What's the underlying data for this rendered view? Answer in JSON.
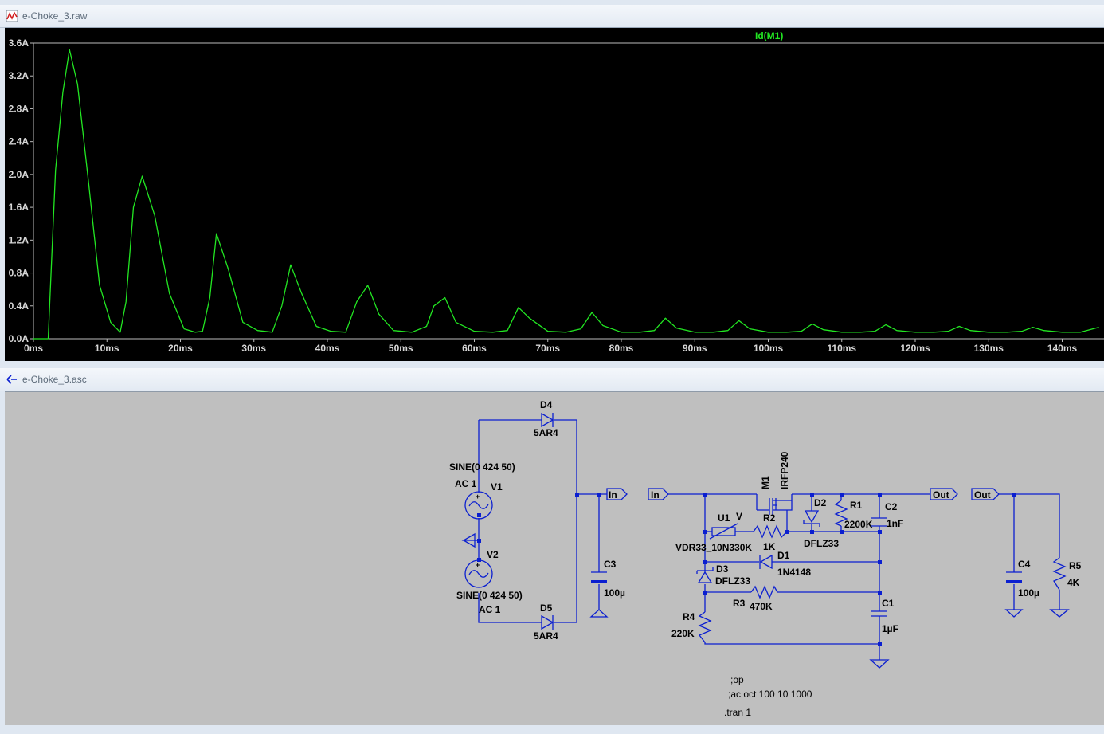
{
  "waveform_window": {
    "title": "e-Choke_3.raw",
    "trace_label": "Id(M1)",
    "trace_color": "#22e622",
    "background_color": "#000000",
    "icon": "waveform-icon"
  },
  "chart_data": {
    "type": "line",
    "title": "",
    "xlabel": "",
    "ylabel": "",
    "x_unit": "ms",
    "y_unit": "A",
    "xlim": [
      0,
      145
    ],
    "ylim": [
      0,
      3.6
    ],
    "x_ticks": [
      "0ms",
      "10ms",
      "20ms",
      "30ms",
      "40ms",
      "50ms",
      "60ms",
      "70ms",
      "80ms",
      "90ms",
      "100ms",
      "110ms",
      "120ms",
      "130ms",
      "140ms"
    ],
    "y_ticks": [
      "0.0A",
      "0.4A",
      "0.8A",
      "1.2A",
      "1.6A",
      "2.0A",
      "2.4A",
      "2.8A",
      "3.2A",
      "3.6A"
    ],
    "grid": false,
    "series": [
      {
        "name": "Id(M1)",
        "color": "#22e622",
        "x": [
          0.0,
          2.0,
          3.0,
          4.0,
          4.9,
          6.0,
          7.5,
          9.0,
          10.5,
          11.8,
          12.6,
          13.6,
          14.8,
          16.5,
          18.5,
          20.5,
          22.0,
          23.0,
          24.0,
          24.9,
          26.5,
          28.5,
          30.5,
          32.5,
          33.8,
          35.0,
          36.5,
          38.5,
          40.5,
          42.5,
          44.0,
          45.5,
          47.0,
          49.0,
          51.5,
          53.5,
          54.5,
          56.0,
          57.5,
          60.0,
          62.5,
          64.5,
          66.0,
          67.5,
          70.0,
          72.5,
          74.5,
          76.0,
          77.5,
          80.0,
          82.5,
          84.5,
          86.0,
          87.5,
          90.0,
          92.5,
          94.5,
          96.0,
          97.5,
          100.0,
          102.5,
          104.5,
          106.0,
          107.5,
          110.0,
          112.5,
          114.5,
          116.0,
          117.5,
          120.0,
          122.5,
          124.5,
          126.0,
          127.5,
          130.0,
          132.5,
          134.5,
          136.0,
          137.5,
          140.0,
          142.5,
          145.0
        ],
        "y": [
          0.0,
          0.0,
          2.05,
          3.0,
          3.52,
          3.1,
          1.9,
          0.65,
          0.2,
          0.08,
          0.45,
          1.6,
          1.98,
          1.5,
          0.55,
          0.12,
          0.08,
          0.09,
          0.5,
          1.28,
          0.85,
          0.2,
          0.1,
          0.08,
          0.4,
          0.9,
          0.55,
          0.15,
          0.09,
          0.08,
          0.45,
          0.65,
          0.3,
          0.1,
          0.08,
          0.15,
          0.4,
          0.5,
          0.2,
          0.09,
          0.08,
          0.1,
          0.38,
          0.25,
          0.09,
          0.08,
          0.12,
          0.32,
          0.16,
          0.08,
          0.08,
          0.1,
          0.25,
          0.13,
          0.08,
          0.08,
          0.1,
          0.22,
          0.12,
          0.08,
          0.08,
          0.09,
          0.18,
          0.11,
          0.08,
          0.08,
          0.09,
          0.17,
          0.1,
          0.08,
          0.08,
          0.09,
          0.15,
          0.1,
          0.08,
          0.08,
          0.09,
          0.14,
          0.1,
          0.08,
          0.08,
          0.14
        ]
      }
    ]
  },
  "schematic_window": {
    "title": "e-Choke_3.asc",
    "icon": "schematic-icon",
    "components": {
      "d4": {
        "ref": "D4",
        "value": "5AR4"
      },
      "d5": {
        "ref": "D5",
        "value": "5AR4"
      },
      "v1": {
        "ref": "V1",
        "spec": "SINE(0 424 50)",
        "ac": "AC 1"
      },
      "v2": {
        "ref": "V2",
        "spec": "SINE(0 424 50)",
        "ac": "AC 1"
      },
      "c3": {
        "ref": "C3",
        "value": "100µ"
      },
      "m1": {
        "ref": "M1",
        "value": "IRFP240"
      },
      "u1": {
        "ref": "U1",
        "value": "VDR33_10N330K"
      },
      "r2": {
        "ref": "R2",
        "value": "1K"
      },
      "d2": {
        "ref": "D2",
        "value": "DFLZ33"
      },
      "r1": {
        "ref": "R1",
        "value": "2200K"
      },
      "c2": {
        "ref": "C2",
        "value": "1nF"
      },
      "d1": {
        "ref": "D1",
        "value": "1N4148"
      },
      "d3": {
        "ref": "D3",
        "value": "DFLZ33"
      },
      "r3": {
        "ref": "R3",
        "value": "470K"
      },
      "r4": {
        "ref": "R4",
        "value": "220K"
      },
      "c1": {
        "ref": "C1",
        "value": "1µF"
      },
      "c4": {
        "ref": "C4",
        "value": "100µ"
      },
      "r5": {
        "ref": "R5",
        "value": "4K"
      }
    },
    "net_labels": {
      "in_a": "In",
      "in_b": "In",
      "out_a": "Out",
      "out_b": "Out"
    },
    "directives": {
      "op": ";op",
      "ac": ";ac oct 100 10 1000",
      "tran": ".tran 1"
    },
    "u1_marker": "V"
  }
}
